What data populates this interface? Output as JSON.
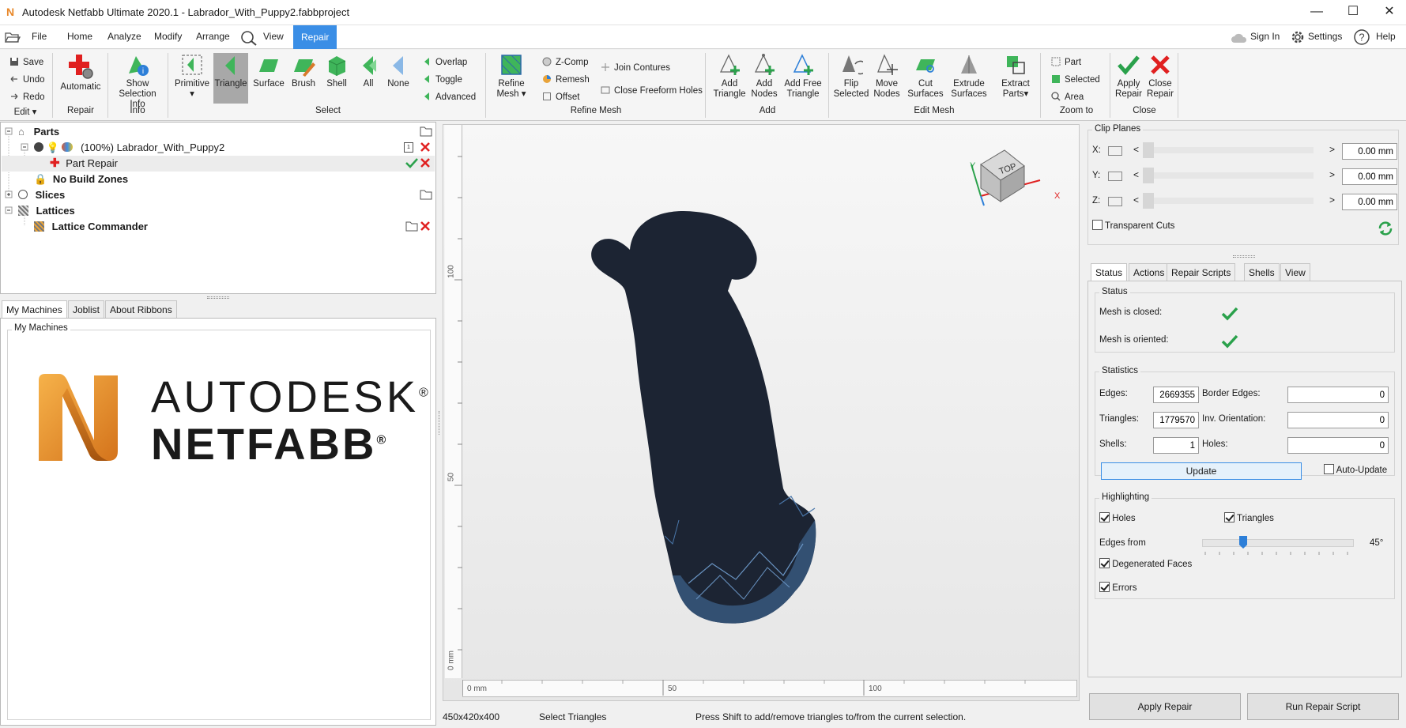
{
  "window": {
    "title": "Autodesk Netfabb Ultimate 2020.1 - Labrador_With_Puppy2.fabbproject",
    "logo_letter": "N",
    "controls": [
      "—",
      "☐",
      "✕"
    ]
  },
  "menu": {
    "file": "File",
    "items": [
      "Home",
      "Analyze",
      "Modify",
      "Arrange"
    ],
    "view": "View",
    "repair": "Repair",
    "sign_in": "Sign In",
    "settings": "Settings",
    "help": "Help"
  },
  "ribbon": {
    "edit": {
      "save": "Save",
      "undo": "Undo",
      "redo": "Redo",
      "label": "Edit"
    },
    "repair": {
      "automatic": "Automatic",
      "label": "Repair"
    },
    "info": {
      "show_selection_1": "Show",
      "show_selection_2": "Selection Info",
      "label": "Info"
    },
    "select": {
      "primitive": "Primitive",
      "triangle": "Triangle",
      "surface": "Surface",
      "brush": "Brush",
      "shell": "Shell",
      "all": "All",
      "none": "None",
      "overlap": "Overlap",
      "toggle": "Toggle",
      "advanced": "Advanced",
      "label": "Select"
    },
    "refine": {
      "refine_1": "Refine",
      "refine_2": "Mesh",
      "zcomp": "Z-Comp",
      "remesh": "Remesh",
      "offset": "Offset",
      "join": "Join Contures",
      "close_freeform": "Close Freeform Holes",
      "label": "Refine Mesh"
    },
    "add": {
      "add_triangle_1": "Add",
      "add_triangle_2": "Triangle",
      "add_nodes_1": "Add",
      "add_nodes_2": "Nodes",
      "add_free_1": "Add Free",
      "add_free_2": "Triangle",
      "label": "Add"
    },
    "edit_mesh": {
      "flip_1": "Flip",
      "flip_2": "Selected",
      "move_1": "Move",
      "move_2": "Nodes",
      "cut_1": "Cut",
      "cut_2": "Surfaces",
      "extrude_1": "Extrude",
      "extrude_2": "Surfaces",
      "extract_1": "Extract",
      "extract_2": "Parts",
      "label": "Edit Mesh"
    },
    "zoom": {
      "part": "Part",
      "selected": "Selected",
      "area": "Area",
      "label": "Zoom to"
    },
    "close": {
      "apply_1": "Apply",
      "apply_2": "Repair",
      "close_1": "Close",
      "close_2": "Repair",
      "label": "Close"
    }
  },
  "tree": {
    "parts": "Parts",
    "part_name": "(100%) Labrador_With_Puppy2",
    "part_repair": "Part Repair",
    "no_build": "No Build Zones",
    "slices": "Slices",
    "lattices": "Lattices",
    "lattice_commander": "Lattice Commander",
    "badge": "1"
  },
  "machines": {
    "tabs": [
      "My Machines",
      "Joblist",
      "About Ribbons"
    ],
    "group": "My Machines",
    "brand_1": "AUTODESK",
    "brand_2": "NETFABB",
    "reg": "®"
  },
  "viewport": {
    "ruler_left": [
      "0 mm",
      "50",
      "100"
    ],
    "ruler_bottom": [
      "0 mm",
      "50",
      "100"
    ],
    "cube_label": "TOP",
    "axis_x": "X",
    "axis_y": "Y"
  },
  "status_bar": {
    "dims": "450x420x400",
    "mode": "Select Triangles",
    "hint": "Press Shift to add/remove triangles to/from the current selection."
  },
  "clip": {
    "title": "Clip Planes",
    "x": "X:",
    "y": "Y:",
    "z": "Z:",
    "x_val": "0.00 mm",
    "y_val": "0.00 mm",
    "z_val": "0.00 mm",
    "transparent": "Transparent Cuts"
  },
  "repair_panel": {
    "tabs": [
      "Status",
      "Actions",
      "Repair Scripts",
      "Shells",
      "View"
    ],
    "status_title": "Status",
    "mesh_closed": "Mesh is closed:",
    "mesh_oriented": "Mesh is oriented:",
    "stats_title": "Statistics",
    "edges": "Edges:",
    "edges_val": "2669355",
    "border_edges": "Border Edges:",
    "border_edges_val": "0",
    "triangles": "Triangles:",
    "triangles_val": "1779570",
    "inv_orient": "Inv. Orientation:",
    "inv_orient_val": "0",
    "shells": "Shells:",
    "shells_val": "1",
    "holes": "Holes:",
    "holes_val": "0",
    "update": "Update",
    "auto_update": "Auto-Update",
    "highlight_title": "Highlighting",
    "hl_holes": "Holes",
    "hl_triangles": "Triangles",
    "edges_from": "Edges from",
    "angle": "45°",
    "angle_value": 45,
    "degenerated": "Degenerated Faces",
    "errors": "Errors"
  },
  "bottom_buttons": {
    "apply": "Apply Repair",
    "run": "Run Repair Script"
  },
  "colors": {
    "accent": "#3a8ee6",
    "green": "#2aa14b",
    "red": "#e02020",
    "mesh": "#1c2433",
    "mesh_edge": "#4a77aa"
  }
}
